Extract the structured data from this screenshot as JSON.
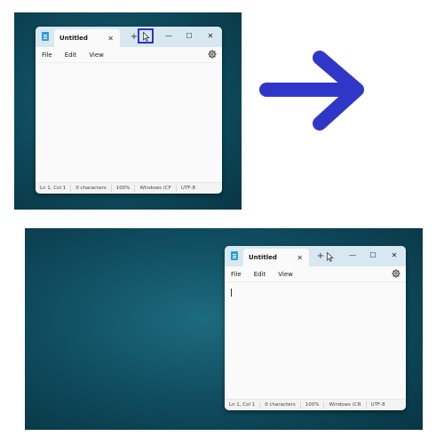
{
  "colors": {
    "highlight": "#3034c9",
    "arrow": "#3037c8",
    "titlebar": "#d7e8f1"
  },
  "step_before": {
    "window": {
      "tab_title": "Untitled",
      "tab_close": "✕",
      "new_tab": "+",
      "controls": {
        "minimize": "—",
        "maximize": "☐",
        "close": "✕"
      }
    },
    "menu": [
      "File",
      "Edit",
      "View"
    ],
    "status": [
      "Ln 1, Col 1",
      "0 characters",
      "100%",
      "Windows (CF",
      "UTF-8"
    ]
  },
  "step_after": {
    "window": {
      "tab_title": "Untitled",
      "tab_close": "✕",
      "new_tab": "+",
      "controls": {
        "minimize": "—",
        "maximize": "☐",
        "close": "✕"
      }
    },
    "menu": [
      "File",
      "Edit",
      "View"
    ],
    "status": [
      "Ln 1, Col 1",
      "0 characters",
      "100%",
      "Windows (CR",
      "UTF-8"
    ]
  },
  "icons": {
    "app": "notepad-icon",
    "settings": "gear-icon",
    "pointer": "mouse-pointer-icon",
    "transition": "right-arrow-icon"
  }
}
